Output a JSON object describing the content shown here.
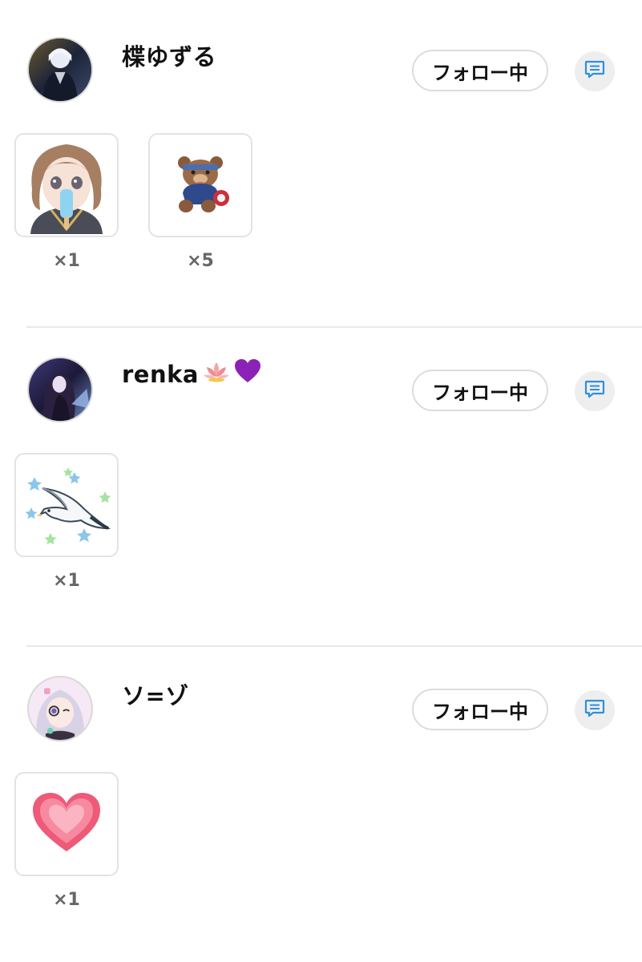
{
  "users": [
    {
      "name": "楪ゆずる",
      "emoji": "",
      "follow_label": "フォロー中",
      "gifts": [
        {
          "icon": "girl-popsicle-sticker",
          "count": "×1"
        },
        {
          "icon": "teddy-bear-sticker",
          "count": "×5"
        }
      ]
    },
    {
      "name": "renka",
      "emoji": "🪷💜",
      "follow_label": "フォロー中",
      "gifts": [
        {
          "icon": "seagull-stars-sticker",
          "count": "×1"
        }
      ]
    },
    {
      "name": "ソ=ゾ",
      "emoji": "",
      "follow_label": "フォロー中",
      "gifts": [
        {
          "icon": "heart-sticker",
          "count": "×1"
        }
      ]
    }
  ],
  "colors": {
    "chat_icon": "#2d8fe0",
    "divider": "#e8e8e8",
    "count_text": "#666666"
  }
}
